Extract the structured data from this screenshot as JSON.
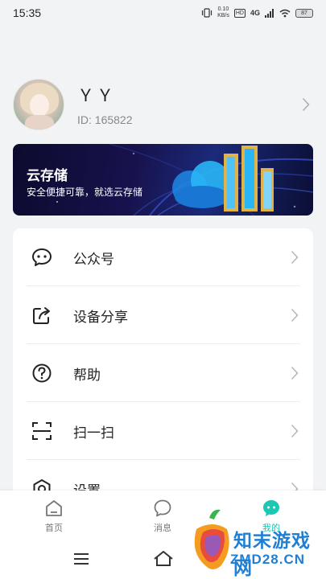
{
  "status_bar": {
    "time": "15:35",
    "net_speed_value": "0.10",
    "net_speed_unit": "KB/s",
    "hd_badge": "HD",
    "network_type": "4G",
    "battery": "87"
  },
  "profile": {
    "username": "ＹＹ",
    "user_id": "ID: 165822"
  },
  "banner": {
    "title": "云存储",
    "subtitle": "安全便捷可靠，就选云存储"
  },
  "menu": {
    "items": [
      {
        "label": "公众号",
        "icon": "wechat-icon"
      },
      {
        "label": "设备分享",
        "icon": "share-icon"
      },
      {
        "label": "帮助",
        "icon": "help-icon"
      },
      {
        "label": "扫一扫",
        "icon": "scan-icon"
      },
      {
        "label": "设置",
        "icon": "settings-icon"
      }
    ]
  },
  "bottom_nav": {
    "items": [
      {
        "label": "首页",
        "icon": "home-icon",
        "active": false
      },
      {
        "label": "消息",
        "icon": "message-icon",
        "active": false
      },
      {
        "label": "我的",
        "icon": "profile-icon",
        "active": true
      }
    ],
    "active_color": "#1cc7b4"
  },
  "watermark": {
    "line1": "知末游戏网",
    "line2": "ZMD28.CN"
  }
}
